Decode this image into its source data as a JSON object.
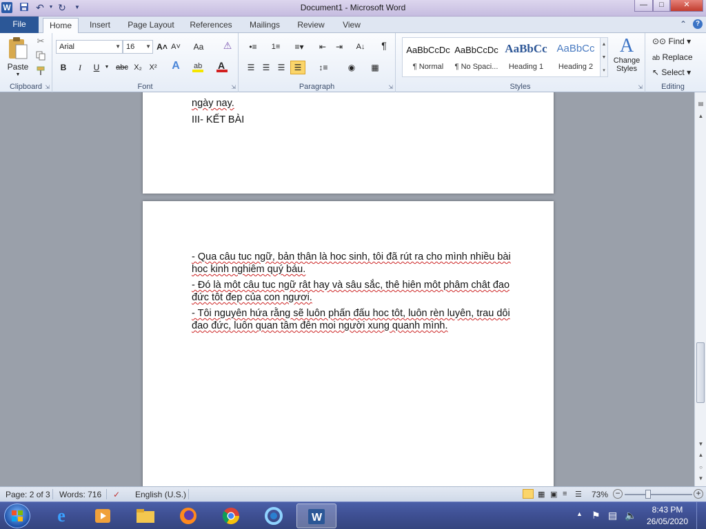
{
  "app": {
    "title": "Document1  -  Microsoft Word",
    "logo_letter": "W"
  },
  "quick_access": {
    "save_icon": "save-icon",
    "undo_icon": "undo-icon",
    "redo_icon": "redo-icon",
    "customize_icon": "customize-qat-icon"
  },
  "window_controls": {
    "minimize": "—",
    "maximize": "□",
    "close": "✕"
  },
  "tabs": {
    "file": "File",
    "items": [
      "Home",
      "Insert",
      "Page Layout",
      "References",
      "Mailings",
      "Review",
      "View"
    ],
    "active": "Home"
  },
  "ribbon": {
    "clipboard": {
      "label": "Clipboard",
      "paste": "Paste"
    },
    "font": {
      "label": "Font",
      "family": "Arial",
      "size": "16",
      "grow": "A˄",
      "shrink": "A˅",
      "change_case": "Aa",
      "bold": "B",
      "italic": "I",
      "underline": "U",
      "strike": "abc",
      "subscript": "X₂",
      "superscript": "X²",
      "font_color_accent": "#d22020",
      "highlight_accent": "#f5e600"
    },
    "paragraph": {
      "label": "Paragraph",
      "show_marks": "¶"
    },
    "styles": {
      "label": "Styles",
      "items": [
        {
          "preview": "AaBbCcDc",
          "name": "¶ Normal"
        },
        {
          "preview": "AaBbCcDc",
          "name": "¶ No Spaci..."
        },
        {
          "preview": "AaBbCc",
          "name": "Heading 1"
        },
        {
          "preview": "AaBbCc",
          "name": "Heading 2"
        }
      ],
      "change_styles": "Change Styles"
    },
    "editing": {
      "label": "Editing",
      "find": "Find",
      "replace": "Replace",
      "select": "Select"
    }
  },
  "document": {
    "page1_lines": [
      "ngày nay.",
      "III- KẾT BÀI"
    ],
    "page2_paragraphs": [
      "- Qua câu tuc ngữ, bản thân là hoc sinh, tôi đã rút ra cho mình nhiều bài hoc kinh nghiêm quý báu.",
      "- Đó là môt câu tuc ngữ rât hay và sâu sắc, thê hiên môt phâm chât đao đức tôt đep của con ngươi.",
      "- Tôi nguyên hứa rằng sẽ luôn phấn đấu hoc tôt, luôn rèn luyên, trau dôi đao đức, luôn quan tâm đên moi người xung quanh mình."
    ]
  },
  "statusbar": {
    "page": "Page: 2 of 3",
    "words": "Words: 716",
    "language": "English (U.S.)",
    "zoom": "73%",
    "zoom_level": 73
  },
  "taskbar": {
    "apps": [
      "internet-explorer-icon",
      "media-player-icon",
      "file-explorer-icon",
      "firefox-icon",
      "chrome-icon",
      "app-icon",
      "word-icon"
    ],
    "active_app": "word-icon",
    "time": "8:43 PM",
    "date": "26/05/2020"
  }
}
